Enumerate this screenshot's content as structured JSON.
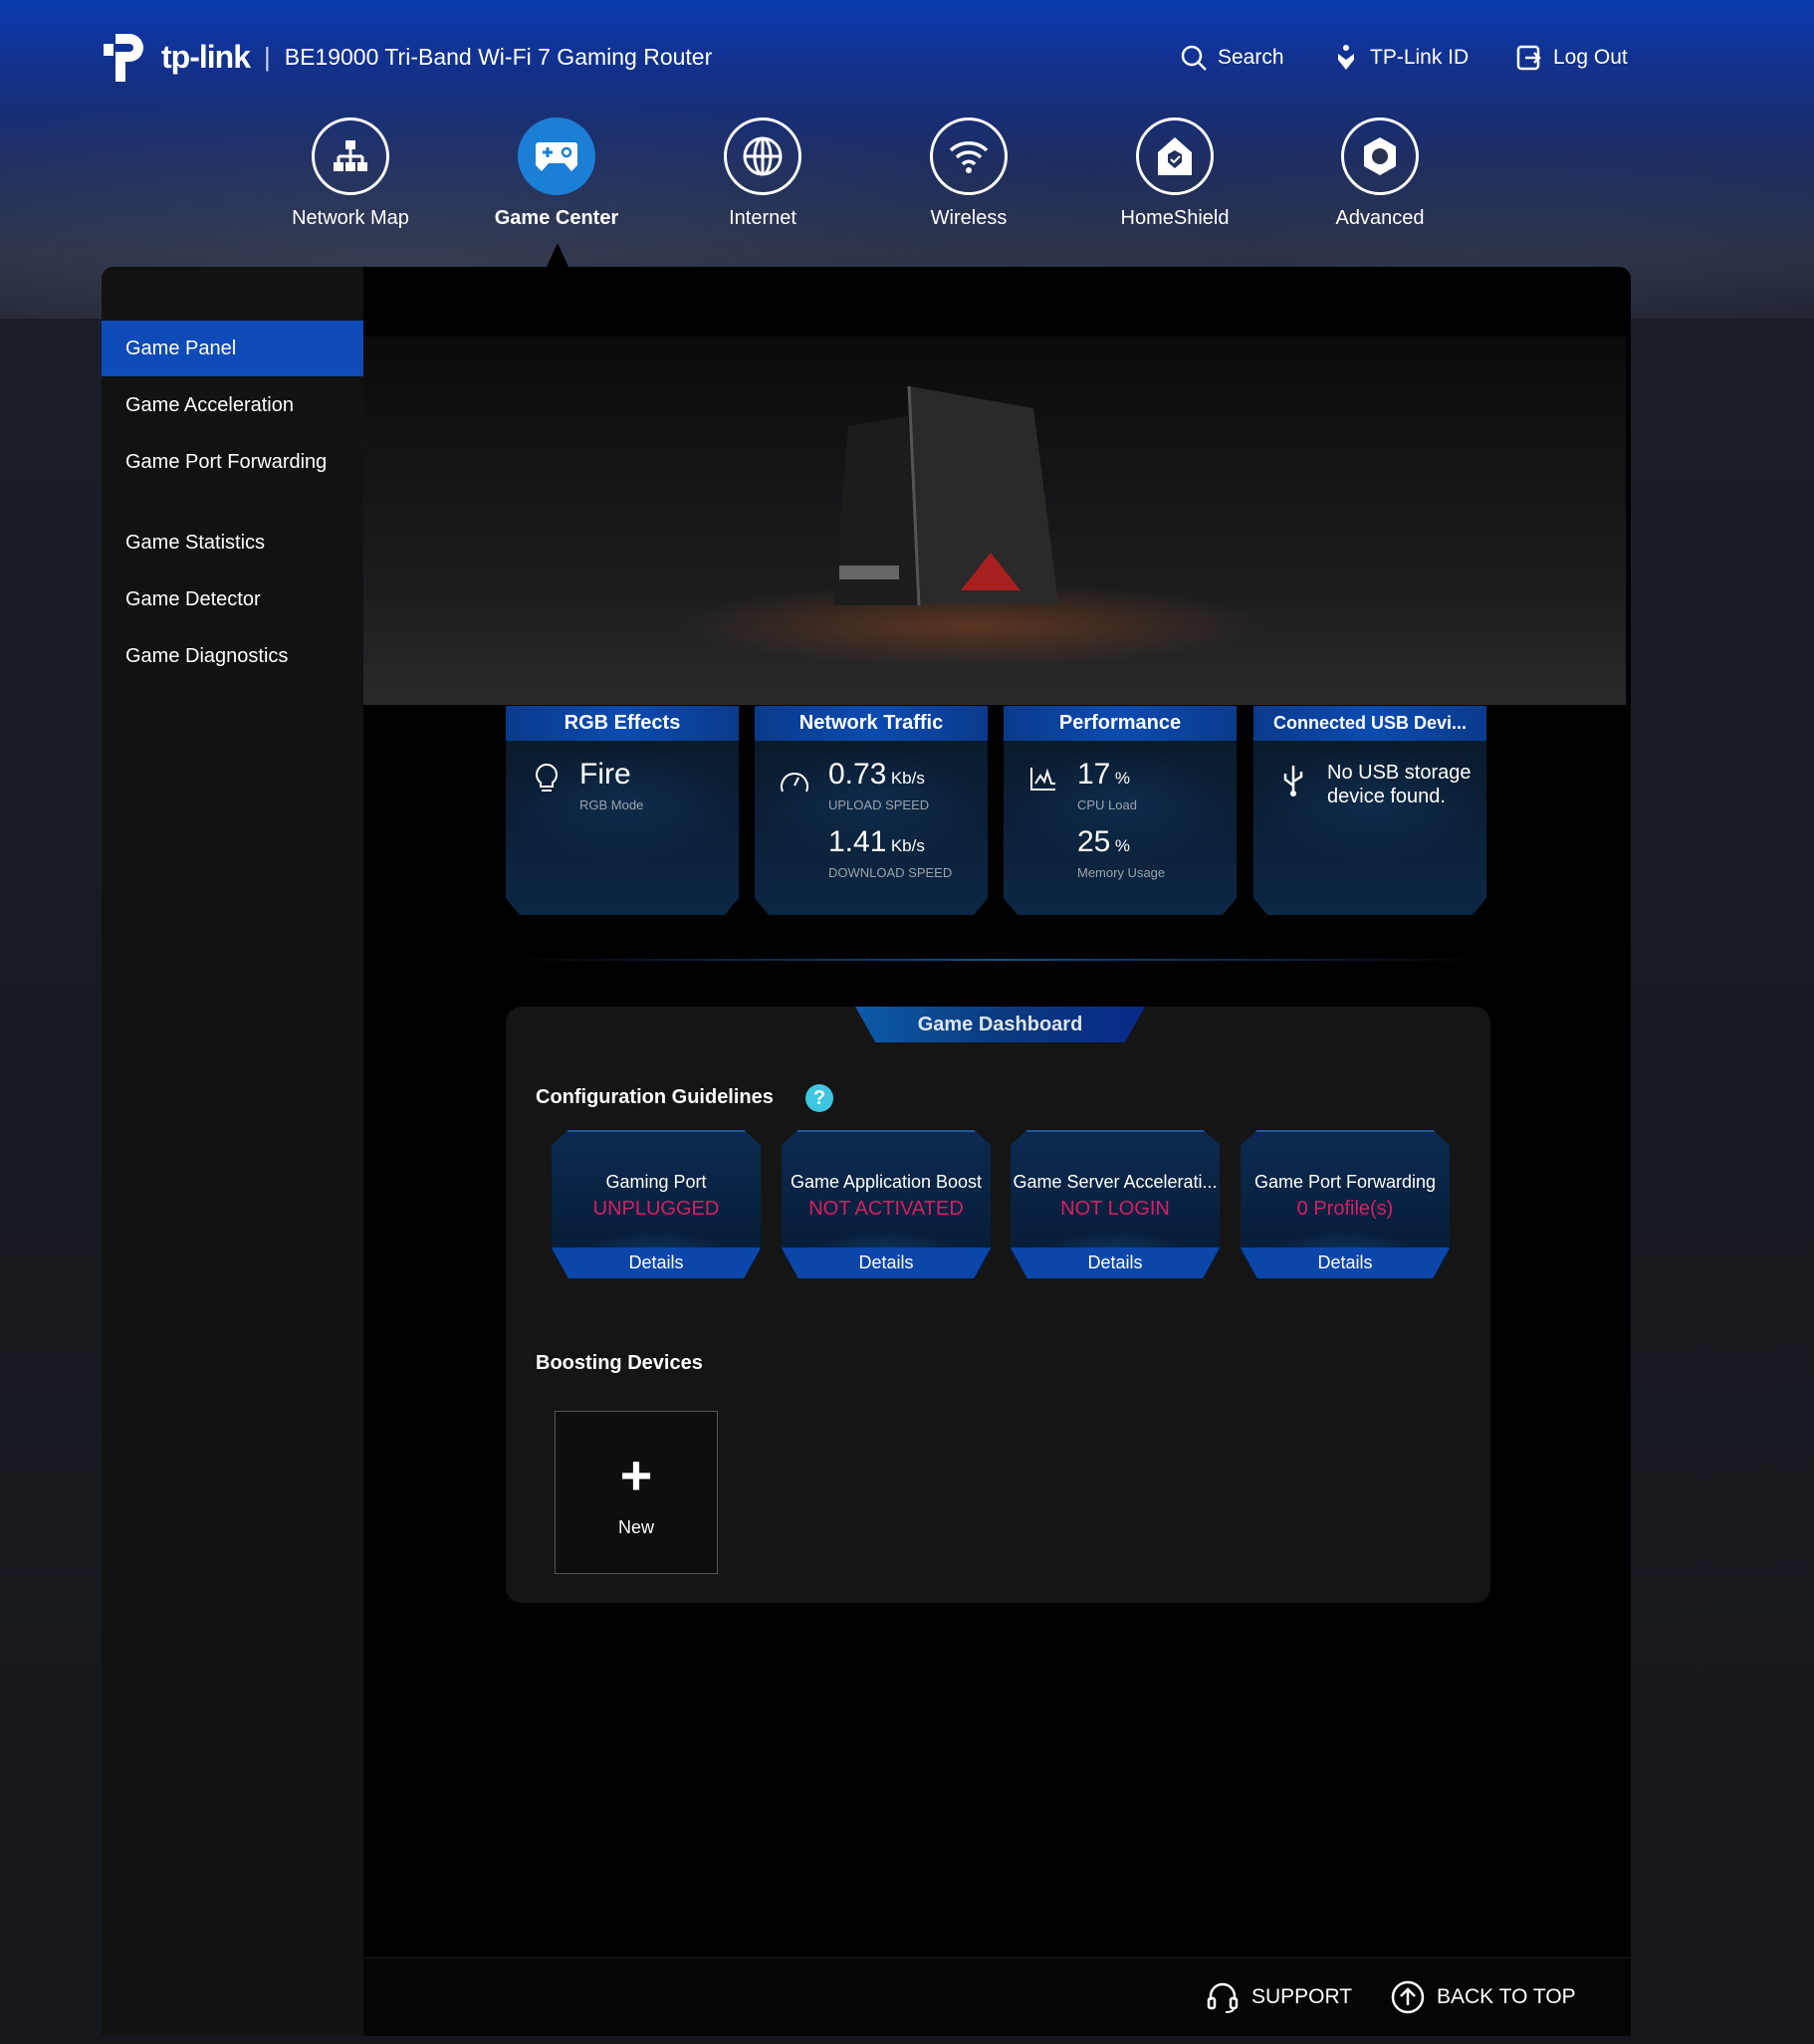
{
  "header": {
    "brand": "tp-link",
    "title": "BE19000 Tri-Band Wi-Fi 7 Gaming Router",
    "links": [
      {
        "label": "Search",
        "icon": "search-icon"
      },
      {
        "label": "TP-Link ID",
        "icon": "tplink-id-icon"
      },
      {
        "label": "Log Out",
        "icon": "logout-icon"
      }
    ]
  },
  "nav": [
    {
      "label": "Network Map",
      "icon": "network-map-icon"
    },
    {
      "label": "Game Center",
      "icon": "gamepad-icon",
      "active": true
    },
    {
      "label": "Internet",
      "icon": "globe-icon"
    },
    {
      "label": "Wireless",
      "icon": "wifi-icon"
    },
    {
      "label": "HomeShield",
      "icon": "homeshield-icon"
    },
    {
      "label": "Advanced",
      "icon": "gear-icon"
    }
  ],
  "sidebar": {
    "items": [
      {
        "label": "Game Panel",
        "active": true
      },
      {
        "label": "Game Acceleration"
      },
      {
        "label": "Game Port Forwarding"
      },
      {
        "label": "Game Statistics"
      },
      {
        "label": "Game Detector"
      },
      {
        "label": "Game Diagnostics"
      }
    ]
  },
  "stats": {
    "rgb": {
      "title": "RGB Effects",
      "value": "Fire",
      "caption": "RGB Mode"
    },
    "traffic": {
      "title": "Network Traffic",
      "upload": "0.73",
      "upload_unit": "Kb/s",
      "upload_caption": "UPLOAD SPEED",
      "download": "1.41",
      "download_unit": "Kb/s",
      "download_caption": "DOWNLOAD SPEED"
    },
    "performance": {
      "title": "Performance",
      "cpu": "17",
      "cpu_unit": "%",
      "cpu_caption": "CPU Load",
      "mem": "25",
      "mem_unit": "%",
      "mem_caption": "Memory Usage"
    },
    "usb": {
      "title": "Connected USB Devi...",
      "message": "No USB storage device found."
    }
  },
  "dashboard": {
    "tab": "Game Dashboard",
    "guidelines_title": "Configuration Guidelines",
    "cards": [
      {
        "title": "Gaming Port",
        "status": "UNPLUGGED",
        "action": "Details"
      },
      {
        "title": "Game Application Boost",
        "status": "NOT ACTIVATED",
        "action": "Details"
      },
      {
        "title": "Game Server Accelerati...",
        "status": "NOT LOGIN",
        "action": "Details"
      },
      {
        "title": "Game Port Forwarding",
        "status": "0 Profile(s)",
        "action": "Details"
      }
    ],
    "boosting_title": "Boosting Devices",
    "new_label": "New"
  },
  "footer": {
    "support": "SUPPORT",
    "back_to_top": "BACK TO TOP"
  },
  "colors": {
    "accent": "#0f4bb8",
    "active_nav": "#1b7fd6",
    "status": "#d81e62",
    "help": "#3fc6e0"
  }
}
